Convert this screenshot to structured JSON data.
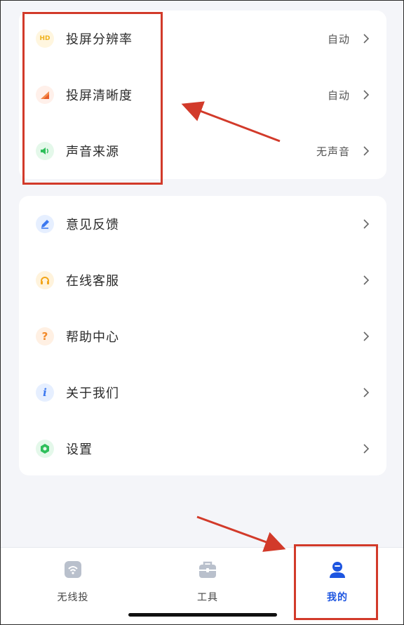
{
  "display_settings": [
    {
      "label": "投屏分辨率",
      "value": "自动",
      "icon": "hd-icon"
    },
    {
      "label": "投屏清晰度",
      "value": "自动",
      "icon": "clarity-icon"
    },
    {
      "label": "声音来源",
      "value": "无声音",
      "icon": "sound-icon"
    }
  ],
  "menu": [
    {
      "label": "意见反馈",
      "icon": "feedback-pen-icon"
    },
    {
      "label": "在线客服",
      "icon": "headset-icon"
    },
    {
      "label": "帮助中心",
      "icon": "help-question-icon"
    },
    {
      "label": "关于我们",
      "icon": "info-icon"
    },
    {
      "label": "设置",
      "icon": "settings-icon"
    }
  ],
  "tabbar": {
    "tabs": [
      {
        "label": "无线投",
        "icon": "wireless-cast-icon",
        "active": false
      },
      {
        "label": "工具",
        "icon": "toolbox-icon",
        "active": false
      },
      {
        "label": "我的",
        "icon": "profile-icon",
        "active": true
      }
    ]
  },
  "hd_badge": "HD",
  "info_glyph": "i",
  "help_glyph": "?",
  "colors": {
    "accent": "#1d55e0",
    "annotation": "#d23a2a"
  }
}
